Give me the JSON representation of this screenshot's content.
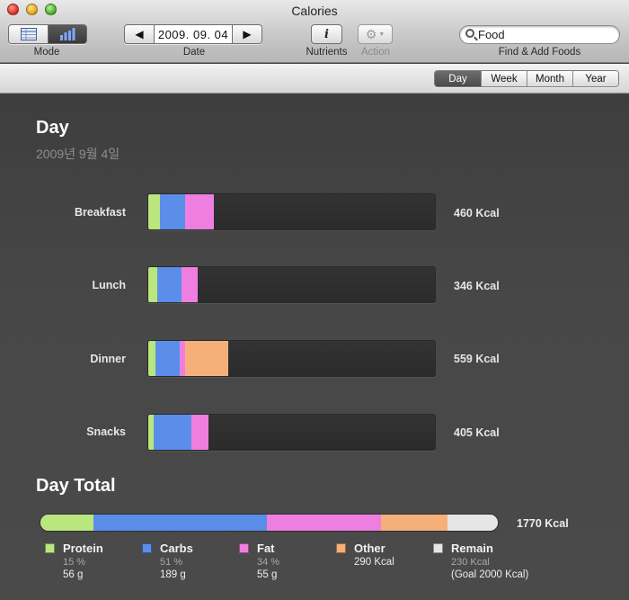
{
  "window": {
    "title": "Calories"
  },
  "toolbar": {
    "mode_label": "Mode",
    "date_label": "Date",
    "date_value": "2009. 09. 04",
    "nutrients_label": "Nutrients",
    "action_label": "Action",
    "search_value": "Food",
    "search_label": "Find & Add Foods"
  },
  "period_tabs": [
    {
      "label": "Day",
      "selected": true
    },
    {
      "label": "Week",
      "selected": false
    },
    {
      "label": "Month",
      "selected": false
    },
    {
      "label": "Year",
      "selected": false
    }
  ],
  "colors": {
    "protein": "#b9e67d",
    "carbs": "#5b8ee8",
    "fat": "#ee7ee0",
    "other": "#f5b07a",
    "remain": "#e6e6e6"
  },
  "day": {
    "title": "Day",
    "date": "2009년 9월 4일"
  },
  "meals": [
    {
      "name": "Breakfast",
      "kcal": "460 Kcal",
      "fractions": {
        "protein": 0.04,
        "carbs": 0.09,
        "fat": 0.1,
        "other": 0
      }
    },
    {
      "name": "Lunch",
      "kcal": "346 Kcal",
      "fractions": {
        "protein": 0.03,
        "carbs": 0.085,
        "fat": 0.058,
        "other": 0
      }
    },
    {
      "name": "Dinner",
      "kcal": "559 Kcal",
      "fractions": {
        "protein": 0.025,
        "carbs": 0.085,
        "fat": 0.02,
        "other": 0.15
      }
    },
    {
      "name": "Snacks",
      "kcal": "405 Kcal",
      "fractions": {
        "protein": 0.02,
        "carbs": 0.13,
        "fat": 0.06,
        "other": 0
      }
    }
  ],
  "total": {
    "title": "Day Total",
    "kcal": "1770 Kcal",
    "fractions": {
      "protein": 0.115,
      "carbs": 0.38,
      "fat": 0.25,
      "other": 0.145,
      "remain": 0.11
    }
  },
  "legend": [
    {
      "key": "protein",
      "name": "Protein",
      "pct": "15 %",
      "value": "56 g"
    },
    {
      "key": "carbs",
      "name": "Carbs",
      "pct": "51 %",
      "value": "189 g"
    },
    {
      "key": "fat",
      "name": "Fat",
      "pct": "34 %",
      "value": "55 g"
    },
    {
      "key": "other",
      "name": "Other",
      "pct": "",
      "value": "290 Kcal"
    },
    {
      "key": "remain",
      "name": "Remain",
      "pct": "230 Kcal",
      "value": "(Goal 2000 Kcal)"
    }
  ]
}
